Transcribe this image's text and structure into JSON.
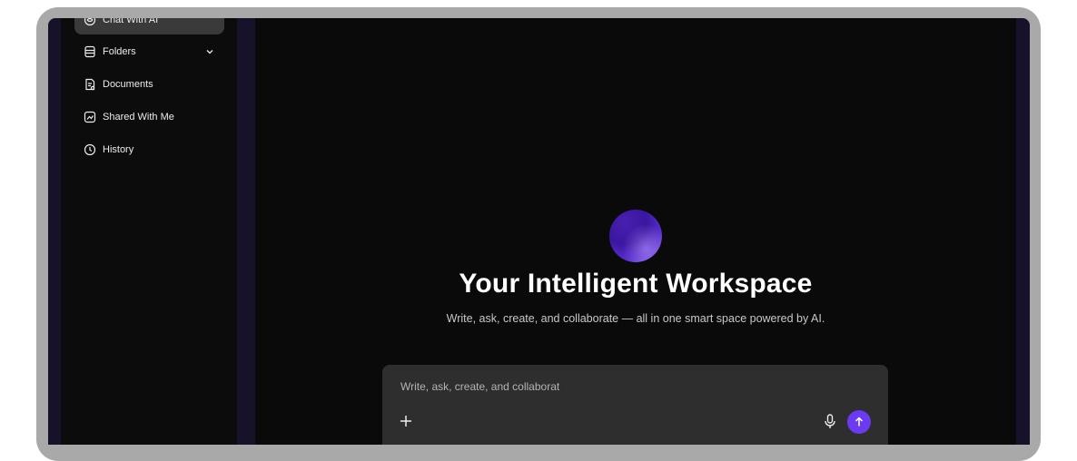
{
  "sidebar": {
    "items": [
      {
        "label": "Chat With AI",
        "icon": "ai-chat-icon",
        "active": true
      },
      {
        "label": "Folders",
        "icon": "folders-icon",
        "expandable": true
      },
      {
        "label": "Documents",
        "icon": "documents-icon"
      },
      {
        "label": "Shared With Me",
        "icon": "shared-icon"
      },
      {
        "label": "History",
        "icon": "history-icon"
      }
    ]
  },
  "main": {
    "title": "Your Intelligent Workspace",
    "subtitle": "Write, ask, create, and collaborate — all in one smart space powered by AI.",
    "composer": {
      "placeholder": "Write, ask, create, and collaborat"
    }
  },
  "colors": {
    "accent": "#6a3bf0",
    "background": "#0a0a0a",
    "frame_gutter": "#17112a"
  }
}
